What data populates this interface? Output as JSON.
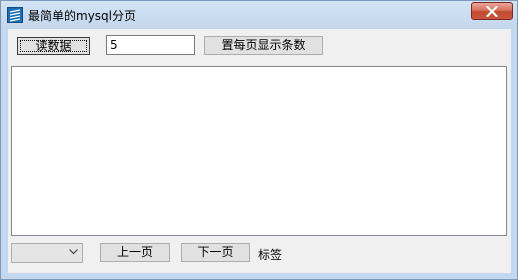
{
  "window": {
    "title": "最简单的mysql分页"
  },
  "toolbar": {
    "read_button": "读数据",
    "page_size_value": "5",
    "set_page_size_button": "置每页显示条数"
  },
  "list": {
    "items": []
  },
  "footer": {
    "combo_value": "",
    "prev_button": "上一页",
    "next_button": "下一页",
    "label_text": "标签"
  },
  "colors": {
    "title_bar": "#c7dbef",
    "close_button": "#c8563c",
    "client_bg": "#f0f0f0"
  },
  "icons": {
    "app": "app-icon",
    "close": "close-icon",
    "combo_arrow": "chevron-down-icon"
  }
}
